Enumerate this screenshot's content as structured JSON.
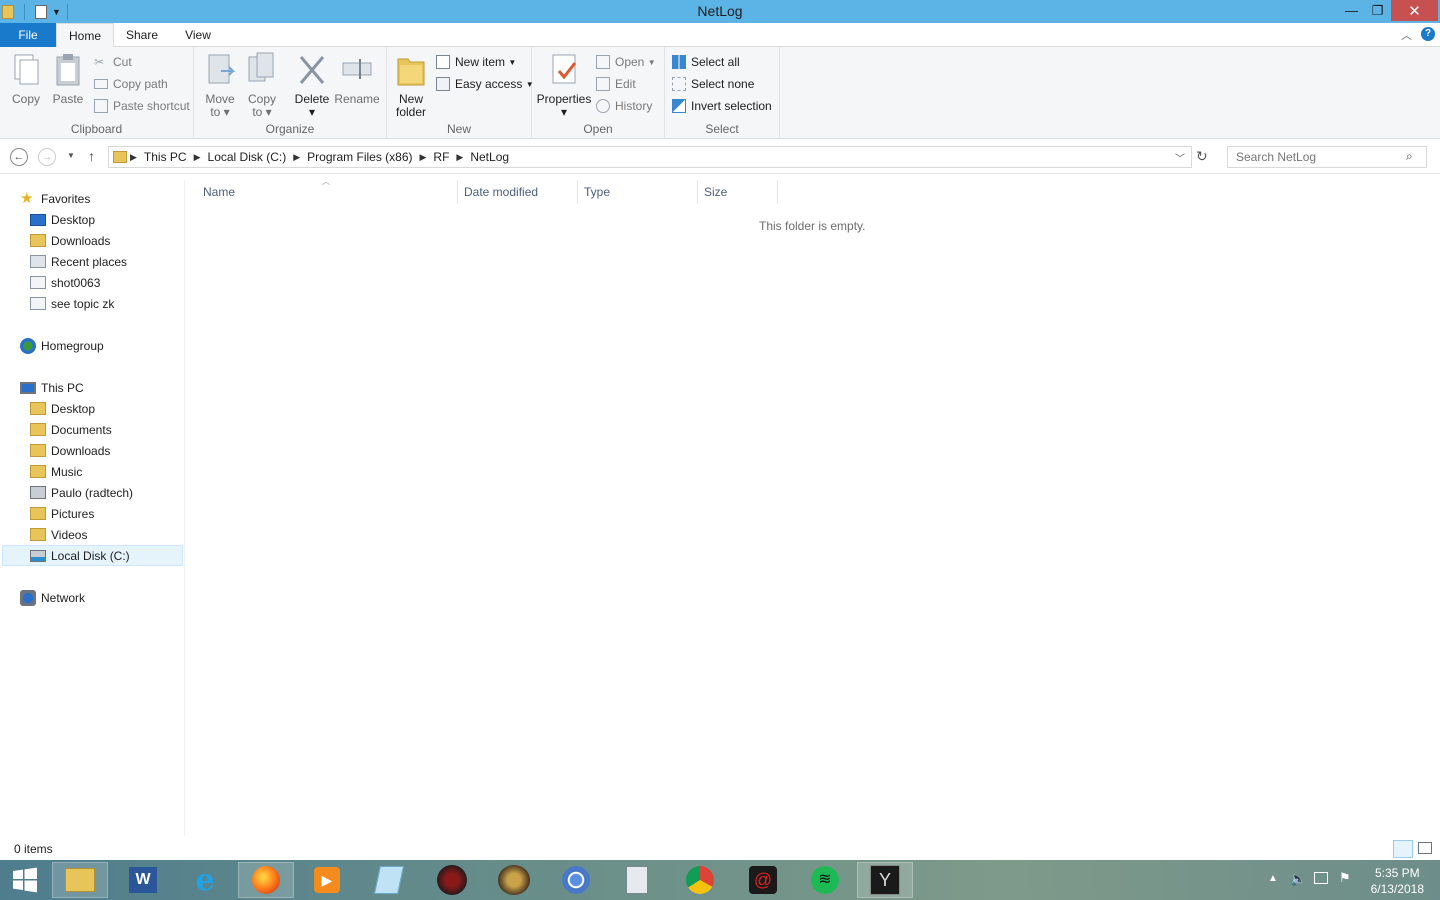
{
  "window": {
    "title": "NetLog"
  },
  "tabs": {
    "file": "File",
    "home": "Home",
    "share": "Share",
    "view": "View"
  },
  "ribbon": {
    "clipboard": {
      "label": "Clipboard",
      "copy": "Copy",
      "paste": "Paste",
      "cut": "Cut",
      "copy_path": "Copy path",
      "paste_shortcut": "Paste shortcut"
    },
    "organize": {
      "label": "Organize",
      "move_to_1": "Move",
      "move_to_2": "to",
      "copy_to_1": "Copy",
      "copy_to_2": "to",
      "delete": "Delete",
      "rename": "Rename"
    },
    "new": {
      "label": "New",
      "new_folder_1": "New",
      "new_folder_2": "folder",
      "new_item": "New item",
      "easy_access": "Easy access"
    },
    "open": {
      "label": "Open",
      "properties": "Properties",
      "open": "Open",
      "edit": "Edit",
      "history": "History"
    },
    "select": {
      "label": "Select",
      "select_all": "Select all",
      "select_none": "Select none",
      "invert_selection": "Invert selection"
    }
  },
  "address": {
    "crumbs": [
      "This PC",
      "Local Disk (C:)",
      "Program Files (x86)",
      "RF",
      "NetLog"
    ],
    "search_placeholder": "Search NetLog"
  },
  "navpane": {
    "favorites": "Favorites",
    "fav_items": [
      "Desktop",
      "Downloads",
      "Recent places",
      "shot0063",
      "see topic zk"
    ],
    "homegroup": "Homegroup",
    "this_pc": "This PC",
    "pc_items": [
      "Desktop",
      "Documents",
      "Downloads",
      "Music",
      "Paulo (radtech)",
      "Pictures",
      "Videos",
      "Local Disk (C:)"
    ],
    "network": "Network"
  },
  "columns": [
    "Name",
    "Date modified",
    "Type",
    "Size"
  ],
  "content": {
    "empty_message": "This folder is empty."
  },
  "status": {
    "count": "0 items"
  },
  "clock": {
    "time": "5:35 PM",
    "date": "6/13/2018"
  },
  "colors": {
    "titlebar": "#5bb3e6",
    "file_tab": "#1979ca",
    "close": "#c75050",
    "selected": "#e5f3fb"
  }
}
